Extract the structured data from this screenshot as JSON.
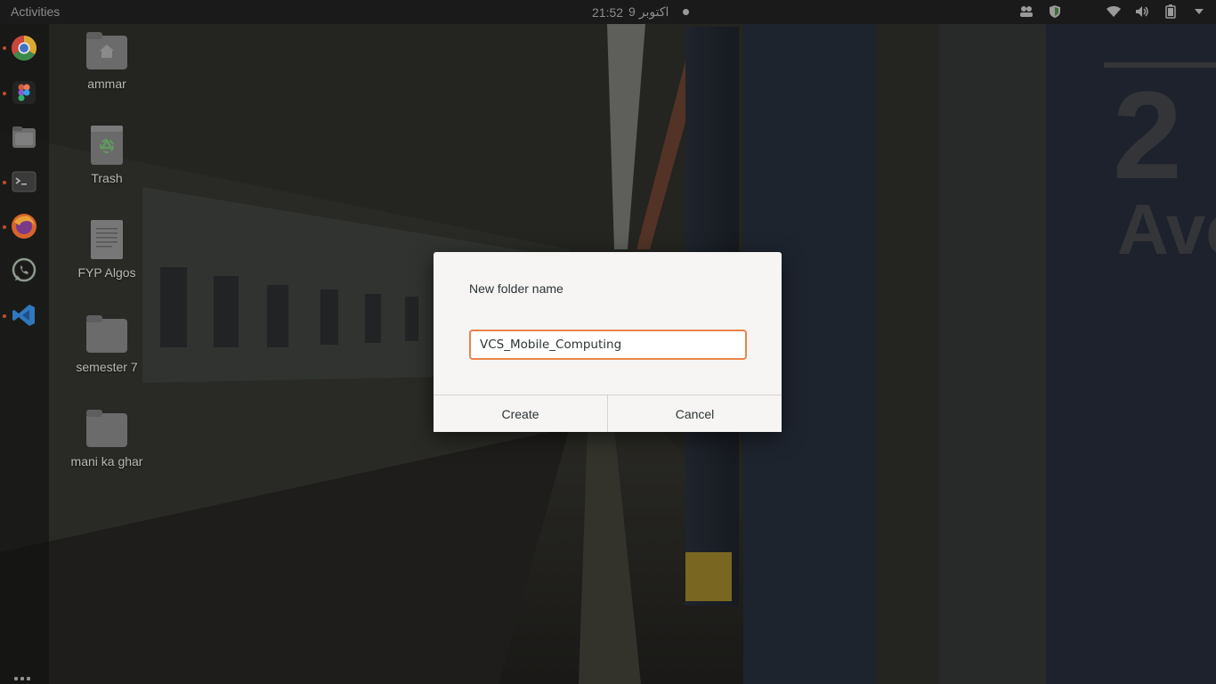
{
  "topbar": {
    "activities_label": "Activities",
    "clock_time": "21:52",
    "clock_date": "9 اکتوبر"
  },
  "tray_icons": [
    "people-icon",
    "shield-icon",
    "wifi-icon",
    "volume-icon",
    "battery-icon",
    "chevron-down-icon"
  ],
  "dock": {
    "items": [
      {
        "name": "chrome-icon",
        "running": true
      },
      {
        "name": "figma-icon",
        "running": true
      },
      {
        "name": "files-icon",
        "running": false
      },
      {
        "name": "terminal-icon",
        "running": true
      },
      {
        "name": "firefox-icon",
        "running": true
      },
      {
        "name": "whatsapp-icon",
        "running": false
      },
      {
        "name": "vscode-icon",
        "running": true
      }
    ]
  },
  "desktop": {
    "icons": [
      {
        "label": "ammar",
        "kind": "home-folder"
      },
      {
        "label": "Trash",
        "kind": "trash"
      },
      {
        "label": "FYP Algos",
        "kind": "document"
      },
      {
        "label": "semester 7",
        "kind": "folder"
      },
      {
        "label": "mani ka ghar",
        "kind": "folder"
      }
    ]
  },
  "dialog": {
    "title": "New folder name",
    "input_value": "VCS_Mobile_Computing",
    "create_label": "Create",
    "cancel_label": "Cancel"
  },
  "colors": {
    "accent": "#e9844a",
    "topbar_bg": "#1a1a1a",
    "dialog_bg": "#f6f5f4",
    "running_indicator": "#c24d2c"
  }
}
